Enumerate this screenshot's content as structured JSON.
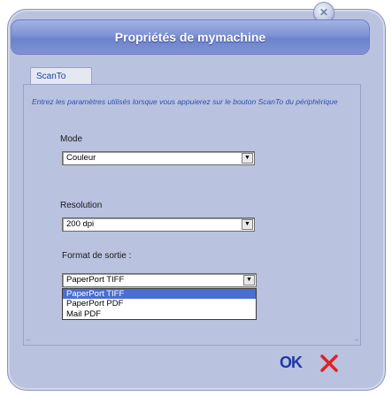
{
  "window": {
    "title": "Propriétés de mymachine",
    "close_icon": "close-icon"
  },
  "tab": {
    "label": "ScanTo"
  },
  "description": "Entrez les paramètres utilisés lorsque vous appuierez sur le bouton ScanTo du périphérique",
  "mode": {
    "label": "Mode",
    "value": "Couleur"
  },
  "resolution": {
    "label": "Resolution",
    "value": "200 dpi"
  },
  "format": {
    "label": "Format de sortie :",
    "value": "PaperPort TIFF",
    "options": [
      "PaperPort TIFF",
      "PaperPort PDF",
      "Mail PDF"
    ]
  },
  "buttons": {
    "ok": "OK",
    "cancel_icon": "cancel-icon"
  },
  "colors": {
    "accent": "#2337a3",
    "cancel": "#e0202a",
    "titlebar": "#7e92d4",
    "selection": "#4a6ed1"
  }
}
